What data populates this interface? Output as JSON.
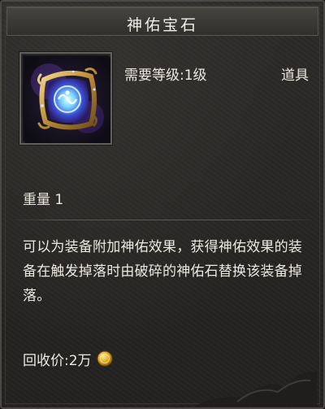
{
  "item": {
    "name": "神佑宝石",
    "required_level": "需要等级:1级",
    "category": "道具",
    "weight": "重量 1",
    "description": "可以为装备附加神佑效果，获得神佑效果的装备在触发掉落时由破碎的神佑石替换该装备掉落。",
    "sell_price": "回收价:2万",
    "icon": "blessing-gem-icon",
    "currency_icon": "gold-coin-icon"
  },
  "colors": {
    "background": "#282624",
    "title_bar": "#3a3935",
    "text": "#ece9e2",
    "gem_glow": "#6ec8ff",
    "gem_frame_gold": "#c9a24a",
    "coin": "#e0a81f"
  }
}
